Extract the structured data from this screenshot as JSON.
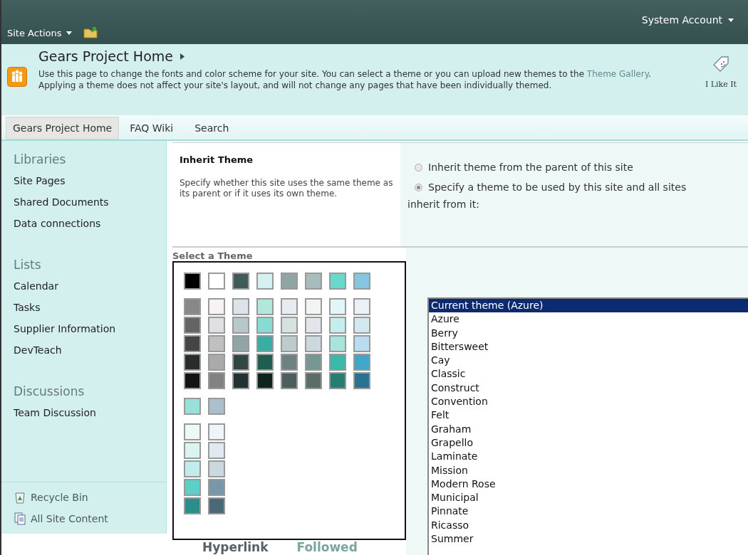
{
  "top_bar": {
    "site_actions": "Site Actions",
    "account": "System Account"
  },
  "header": {
    "title": "Gears Project Home",
    "description_start": "Use this page to change the fonts and color scheme for your site. You can select a theme or you can upload new themes to the",
    "description_link": "Theme Gallery",
    "description_end": ". Applying a theme does not affect your site's layout, and will not change any pages that have been individually themed.",
    "like_label": "I Like It"
  },
  "nav_tabs": [
    {
      "label": "Gears Project Home",
      "selected": true
    },
    {
      "label": "FAQ Wiki",
      "selected": false
    },
    {
      "label": "Search",
      "selected": false
    }
  ],
  "sidebar": {
    "groups": [
      {
        "heading": "Libraries",
        "items": [
          "Site Pages",
          "Shared Documents",
          "Data connections"
        ]
      },
      {
        "heading": "Lists",
        "items": [
          "Calendar",
          "Tasks",
          "Supplier Information",
          "DevTeach"
        ]
      },
      {
        "heading": "Discussions",
        "items": [
          "Team Discussion"
        ]
      }
    ],
    "footer_links": [
      {
        "kind": "recycle",
        "label": "Recycle Bin"
      },
      {
        "kind": "content",
        "label": "All Site Content"
      }
    ]
  },
  "inherit_section": {
    "title": "Inherit Theme",
    "description": "Specify whether this site uses the same theme as its parent or if it uses its own theme.",
    "options": [
      {
        "label": "Inherit theme from the parent of this site",
        "selected": false
      },
      {
        "label": "Specify a theme to be used by this site and all sites",
        "selected": true
      }
    ],
    "continuation": "inherit from it:"
  },
  "theme_preview": {
    "title": "Select a Theme",
    "top_row": [
      {
        "color": "#000000"
      },
      {
        "color": "#ffffff"
      },
      {
        "color": "#415a5a"
      },
      {
        "color": "#d5f0f0"
      },
      {
        "color": "#8fa5a3"
      },
      {
        "color": "#a6bcbd"
      },
      {
        "color": "#66d8cc"
      },
      {
        "color": "#86c6e0"
      }
    ],
    "grid_rows": [
      [
        {
          "color": "#888886"
        },
        {
          "color": "#f6f2f6"
        },
        {
          "color": "#dde3ea"
        },
        {
          "color": "#b2e8dc"
        },
        {
          "color": "#e8ecf2"
        },
        {
          "color": "#f2f4f2"
        },
        {
          "color": "#e0f6f8"
        },
        {
          "color": "#eaf2f8"
        }
      ],
      [
        {
          "color": "#646464"
        },
        {
          "color": "#e0dfe2"
        },
        {
          "color": "#b6c8cc"
        },
        {
          "color": "#86dcd2"
        },
        {
          "color": "#d6e2e0"
        },
        {
          "color": "#e2e6ea"
        },
        {
          "color": "#c4eeee"
        },
        {
          "color": "#d0e8ee"
        }
      ],
      [
        {
          "color": "#444644"
        },
        {
          "color": "#c0c0c0"
        },
        {
          "color": "#8fa5a7"
        },
        {
          "color": "#3aaea2"
        },
        {
          "color": "#bcccca"
        },
        {
          "color": "#ccd8dc"
        },
        {
          "color": "#a6e4dc"
        },
        {
          "color": "#b8dcf0"
        }
      ],
      [
        {
          "color": "#282c2a"
        },
        {
          "color": "#aaaaaa"
        },
        {
          "color": "#324644"
        },
        {
          "color": "#205e52"
        },
        {
          "color": "#6e8282"
        },
        {
          "color": "#759894"
        },
        {
          "color": "#3ab8aa"
        },
        {
          "color": "#42a6c8"
        }
      ],
      [
        {
          "color": "#111411"
        },
        {
          "color": "#828380"
        },
        {
          "color": "#223134"
        },
        {
          "color": "#10241e"
        },
        {
          "color": "#4e5e5c"
        },
        {
          "color": "#5a6e66"
        },
        {
          "color": "#267e72"
        },
        {
          "color": "#287490"
        }
      ]
    ],
    "accent_row": [
      {
        "color": "#98e0da"
      },
      {
        "color": "#abc0ca"
      }
    ],
    "pair_rows": [
      [
        {
          "color": "#eef8f6"
        },
        {
          "color": "#f0f4f8"
        }
      ],
      [
        {
          "color": "#daf4f0"
        },
        {
          "color": "#e2e8f2"
        }
      ],
      [
        {
          "color": "#c2ecea"
        },
        {
          "color": "#cad8e0"
        }
      ],
      [
        {
          "color": "#5ad0c6"
        },
        {
          "color": "#7898aa"
        }
      ],
      [
        {
          "color": "#2c8e88"
        },
        {
          "color": "#4a6878"
        }
      ]
    ],
    "hyperlink": "Hyperlink",
    "followed": "Followed"
  },
  "theme_list": [
    {
      "label": "Current theme (Azure)",
      "selected": true
    },
    {
      "label": "Azure",
      "selected": false
    },
    {
      "label": "Berry",
      "selected": false
    },
    {
      "label": "Bittersweet",
      "selected": false
    },
    {
      "label": "Cay",
      "selected": false
    },
    {
      "label": "Classic",
      "selected": false
    },
    {
      "label": "Construct",
      "selected": false
    },
    {
      "label": "Convention",
      "selected": false
    },
    {
      "label": "Felt",
      "selected": false
    },
    {
      "label": "Graham",
      "selected": false
    },
    {
      "label": "Grapello",
      "selected": false
    },
    {
      "label": "Laminate",
      "selected": false
    },
    {
      "label": "Mission",
      "selected": false
    },
    {
      "label": "Modern Rose",
      "selected": false
    },
    {
      "label": "Municipal",
      "selected": false
    },
    {
      "label": "Pinnate",
      "selected": false
    },
    {
      "label": "Ricasso",
      "selected": false
    },
    {
      "label": "Summer",
      "selected": false
    }
  ]
}
